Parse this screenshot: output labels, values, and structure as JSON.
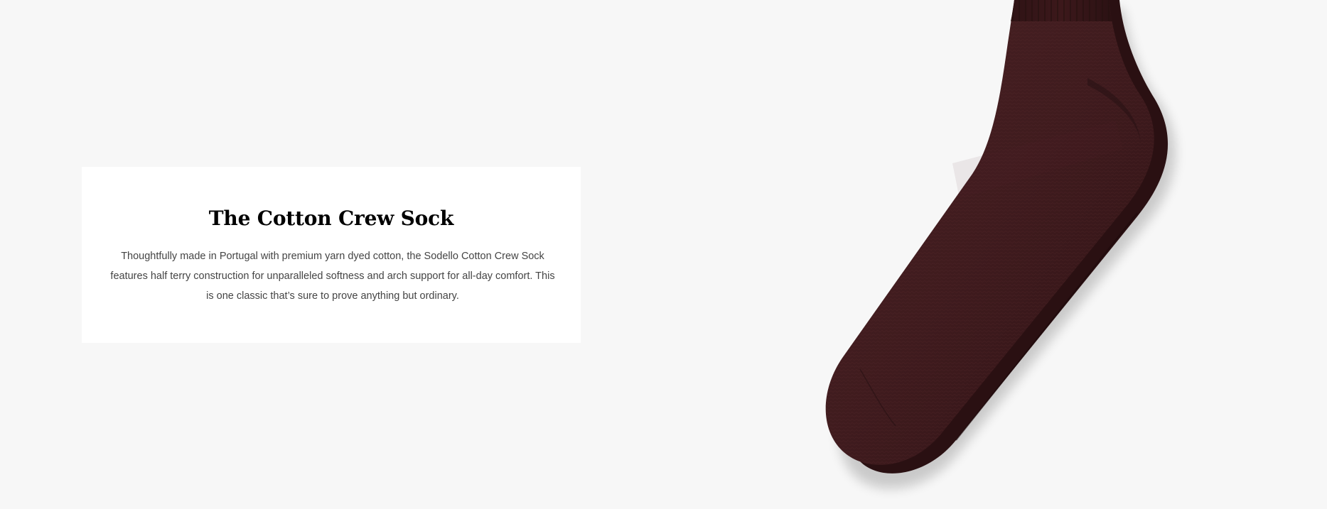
{
  "product": {
    "title": "The Cotton Crew Sock",
    "description": "Thoughtfully made in Portugal with premium yarn dyed cotton, the Sodello Cotton Crew Sock features half terry construction for unparalleled softness and arch support for all-day comfort. This is one classic that’s sure to prove anything but ordinary."
  },
  "colors": {
    "background": "#f7f7f7",
    "card": "#ffffff",
    "title": "#000000",
    "body_text": "#444444",
    "sock": "#3d1a1c"
  },
  "image": {
    "subject": "burgundy-crew-sock"
  }
}
